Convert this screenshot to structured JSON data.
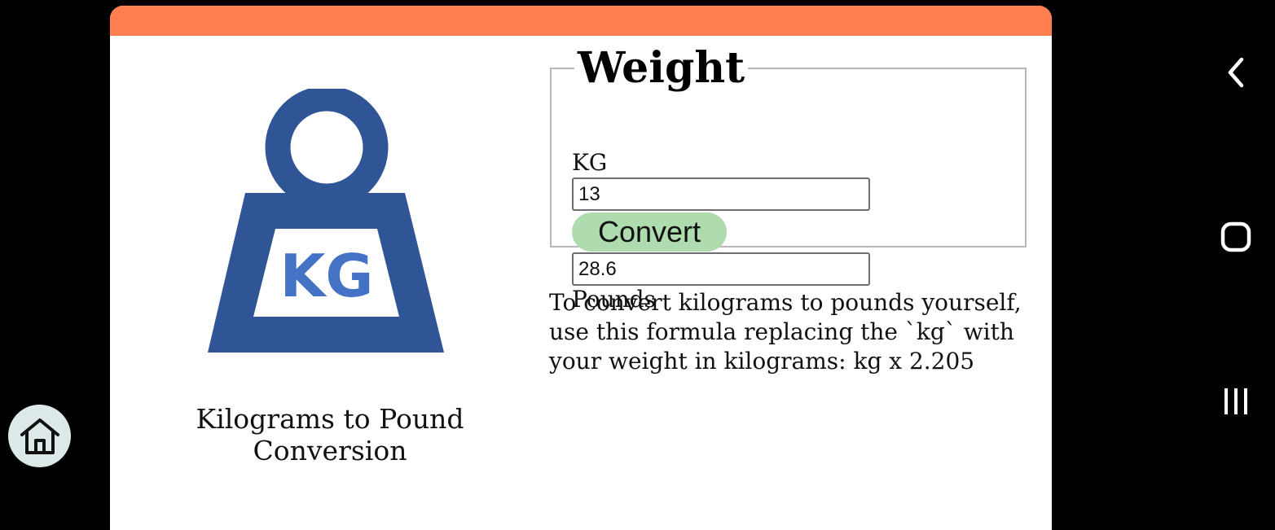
{
  "app": {
    "accent_color": "#ff7f50",
    "caption": "Kilograms to Pound Conversion",
    "illustration": {
      "icon": "kg-weight-icon",
      "text": "KG",
      "color": "#2f5597",
      "text_color": "#4472c4"
    }
  },
  "converter": {
    "legend": "Weight",
    "kg_label": "KG",
    "kg_value": "13",
    "convert_label": "Convert",
    "convert_color": "#afdcae",
    "result_value": "28.6",
    "pounds_label": "Pounds"
  },
  "help_text": "To convert kilograms to pounds yourself, use this formula replacing the `kg` with your weight in kilograms: kg x 2.205",
  "floating_home": {
    "icon": "home-icon"
  },
  "system_nav": {
    "back_icon": "chevron-left-icon",
    "home_icon": "rounded-square-icon",
    "recents_icon": "three-bars-icon"
  }
}
